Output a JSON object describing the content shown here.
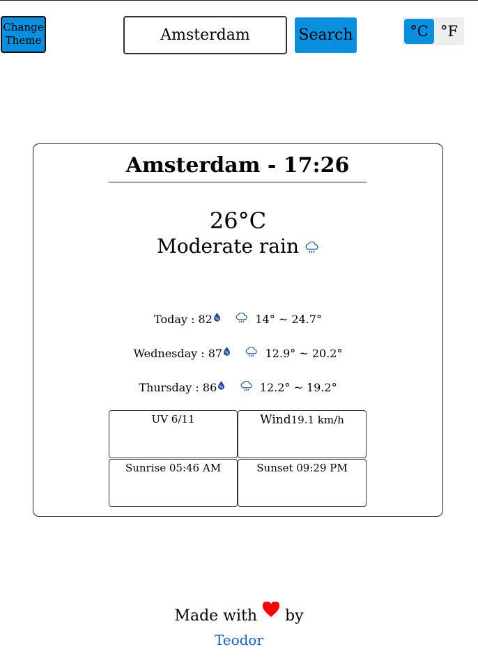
{
  "header": {
    "theme_button": "Change Theme",
    "search_value": "Amsterdam",
    "search_button": "Search",
    "unit_celsius": "°C",
    "unit_fahrenheit": "°F",
    "active_unit": "°C"
  },
  "current": {
    "title": "Amsterdam - 17:26",
    "temperature": "26°C",
    "condition": "Moderate rain",
    "condition_icon": "rain-cloud-icon"
  },
  "forecast": [
    {
      "label": "Today : 82",
      "humidity_icon": "humidity-drop-icon",
      "weather_icon": "rain-cloud-icon",
      "range": "14° ~ 24.7°"
    },
    {
      "label": "Wednesday : 87",
      "humidity_icon": "humidity-drop-icon",
      "weather_icon": "rain-cloud-icon",
      "range": "12.9° ~ 20.2°"
    },
    {
      "label": "Thursday : 86",
      "humidity_icon": "humidity-drop-icon",
      "weather_icon": "rain-cloud-icon",
      "range": "12.2° ~ 19.2°"
    }
  ],
  "details": {
    "uv_label": "UV",
    "uv_value": "6/11",
    "wind_label": "Wind",
    "wind_value": "19.1 km/h",
    "sunrise_label": "Sunrise",
    "sunrise_value": "05:46 AM",
    "sunset_label": "Sunset",
    "sunset_value": "09:29 PM"
  },
  "footer": {
    "made_with": "Made with",
    "by": "by",
    "heart_icon": "heart-icon",
    "author": "Teodor"
  },
  "colors": {
    "accent": "#0a8fdf",
    "link": "#1a5fbf",
    "heart": "#ff0000",
    "icon": "#1f4d8f"
  }
}
